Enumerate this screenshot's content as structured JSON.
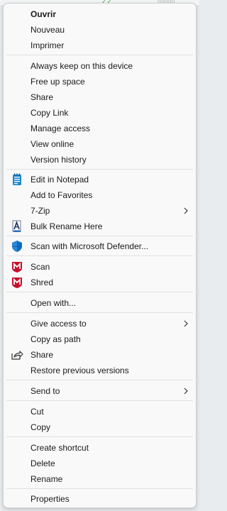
{
  "menu": {
    "open": "Ouvrir",
    "new": "Nouveau",
    "print": "Imprimer",
    "keep_on_device": "Always keep on this device",
    "free_up_space": "Free up space",
    "share_onedrive": "Share",
    "copy_link": "Copy Link",
    "manage_access": "Manage access",
    "view_online": "View online",
    "version_history": "Version history",
    "edit_notepad": "Edit in Notepad",
    "add_favorites": "Add to Favorites",
    "seven_zip": "7-Zip",
    "bulk_rename": "Bulk Rename Here",
    "scan_defender": "Scan with Microsoft Defender...",
    "scan_mcafee": "Scan",
    "shred": "Shred",
    "open_with": "Open with...",
    "give_access": "Give access to",
    "copy_as_path": "Copy as path",
    "share": "Share",
    "restore_versions": "Restore previous versions",
    "send_to": "Send to",
    "cut": "Cut",
    "copy": "Copy",
    "create_shortcut": "Create shortcut",
    "delete": "Delete",
    "rename": "Rename",
    "properties": "Properties"
  },
  "colors": {
    "notepad": "#1e88c8",
    "defender": "#0f6cbd",
    "mcafee": "#c8102e",
    "text": "#1a1a1a"
  }
}
